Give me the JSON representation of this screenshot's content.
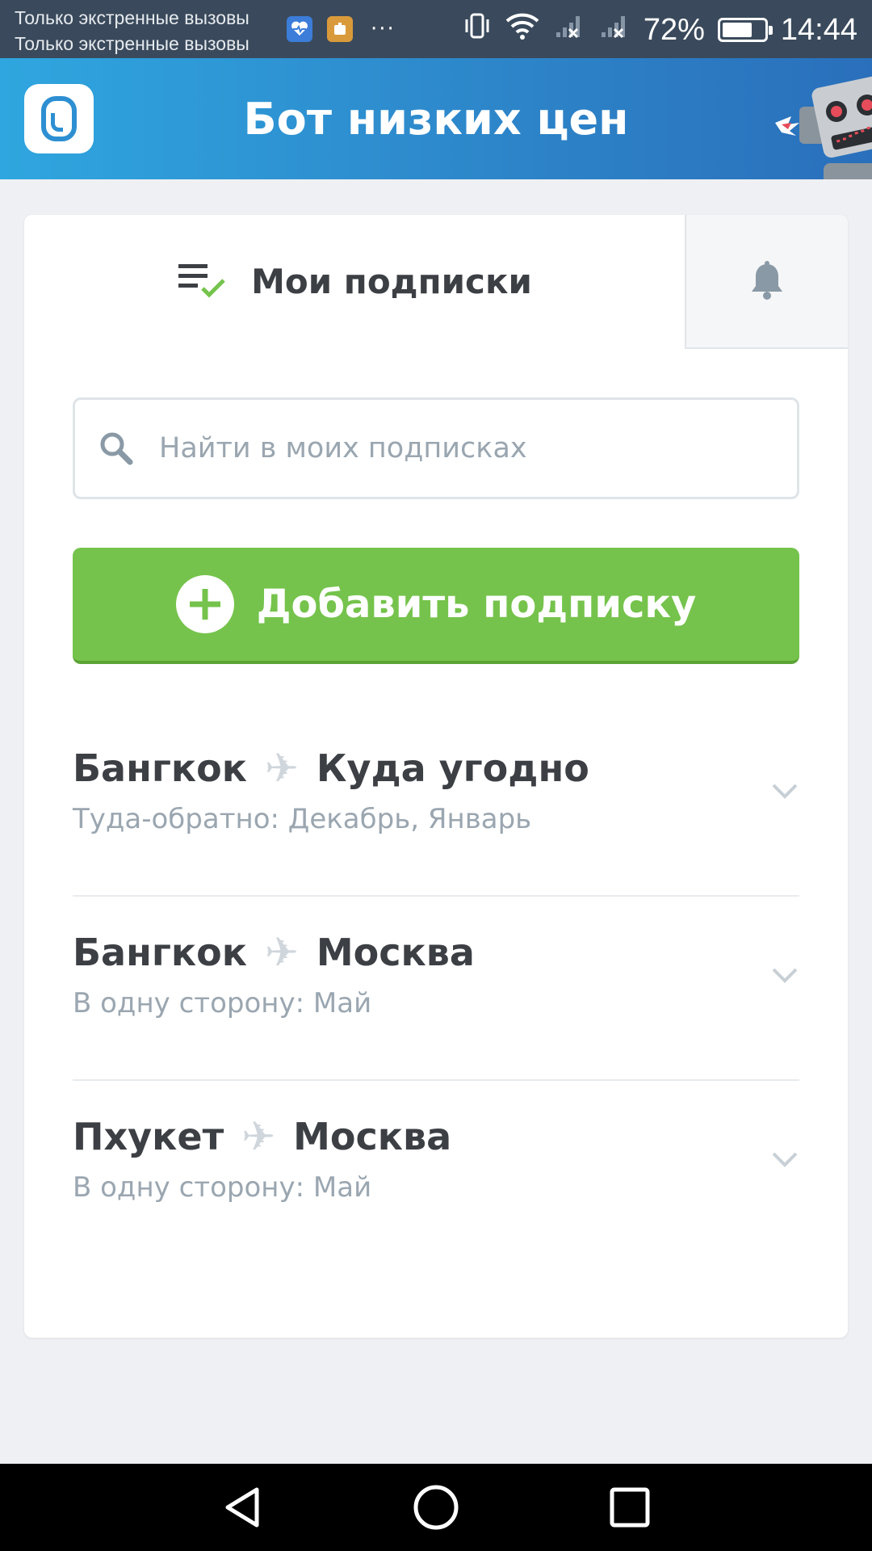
{
  "status_bar": {
    "line1": "Только экстренные вызовы",
    "line2": "Только экстренные вызовы",
    "dots": "···",
    "battery_percent_text": "72%",
    "battery_level": 0.72,
    "time": "14:44"
  },
  "header": {
    "title": "Бот низких цен"
  },
  "tabs": {
    "subscriptions_label": "Мои подписки"
  },
  "search": {
    "placeholder": "Найти в моих подписках",
    "value": ""
  },
  "add_button": {
    "label": "Добавить подписку"
  },
  "subscriptions": [
    {
      "from": "Бангкок",
      "to": "Куда угодно",
      "details": "Туда-обратно: Декабрь, Январь"
    },
    {
      "from": "Бангкок",
      "to": "Москва",
      "details": "В одну сторону: Май"
    },
    {
      "from": "Пхукет",
      "to": "Москва",
      "details": "В одну сторону: Май"
    }
  ],
  "colors": {
    "header_start": "#2fa6df",
    "header_end": "#2a6fbb",
    "accent_green": "#75c34c",
    "text_dark": "#3c3f44",
    "text_muted": "#9aa6b0"
  },
  "icons": {
    "list_check": "list-check-icon",
    "bell": "bell-icon",
    "search": "search-icon",
    "plus": "plus-icon",
    "plane": "plane-icon",
    "chevron": "chevron-down-icon"
  }
}
